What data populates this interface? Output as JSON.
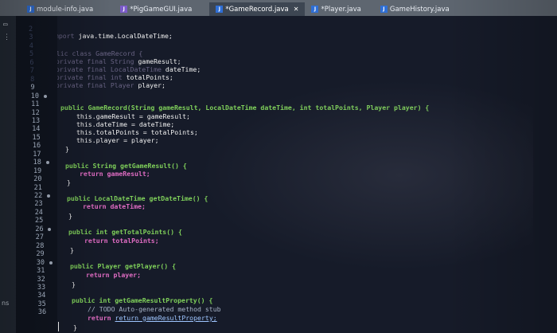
{
  "tabs": [
    {
      "label": "module-info.java",
      "icon": "java-module-icon",
      "active": false
    },
    {
      "label": "*PigGameGUI.java",
      "icon": "java-file-icon",
      "active": false
    },
    {
      "label": "*GameRecord.java",
      "icon": "java-file-icon",
      "active": true,
      "close": "✕"
    },
    {
      "label": "*Player.java",
      "icon": "java-file-icon",
      "active": false
    },
    {
      "label": "GameHistory.java",
      "icon": "java-file-icon",
      "active": false
    }
  ],
  "left_panel_text": "ns",
  "line_numbers": [
    "2",
    "3",
    "4",
    "5",
    "6",
    "7",
    "8",
    "9",
    "10",
    "11",
    "12",
    "13",
    "14",
    "15",
    "16",
    "17",
    "18",
    "19",
    "20",
    "21",
    "22",
    "23",
    "24",
    "25",
    "26",
    "27",
    "28",
    "29",
    "30",
    "31",
    "32",
    "33",
    "34",
    "35",
    "36"
  ],
  "code": {
    "import": "java.time.LocalDateTime;",
    "class_decl": "GameRecord {",
    "field1": "gameResult;",
    "field2": "dateTime;",
    "field3": "totalPoints;",
    "field4": "player;",
    "ctor_sig": "public GameRecord(String gameResult, LocalDateTime dateTime, int totalPoints, Player player) {",
    "ctor1": "this.gameResult = gameResult;",
    "ctor2": "this.dateTime = dateTime;",
    "ctor3": "this.totalPoints = totalPoints;",
    "ctor4": "this.player = player;",
    "m1_sig": "public String getGameResult() {",
    "m1_body": "return gameResult;",
    "m2_sig": "public LocalDateTime getDateTime() {",
    "m2_body": "return dateTime;",
    "m3_sig": "public int getTotalPoints() {",
    "m3_body": "return totalPoints;",
    "m4_sig": "public Player getPlayer() {",
    "m4_body": "return player;",
    "m5_sig": "public int getGameResultProperty() {",
    "m5_comment": "// TODO Auto-generated method stub",
    "m5_body": "return gameResultProperty;",
    "close_brace": "}"
  }
}
